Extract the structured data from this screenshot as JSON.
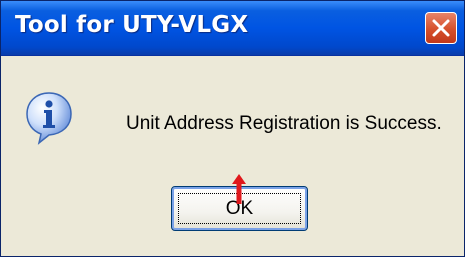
{
  "dialog": {
    "title": "Tool for UTY-VLGX",
    "message": "Unit Address Registration is Success.",
    "ok_label": "OK"
  },
  "icons": {
    "dialog_icon": "info-icon",
    "close": "close-icon",
    "annotation": "arrow-up-icon"
  },
  "colors": {
    "titlebar": "#0054e3",
    "close_button": "#d6502b",
    "dialog_background": "#ece9d8",
    "annotation_arrow": "#e0181c"
  }
}
